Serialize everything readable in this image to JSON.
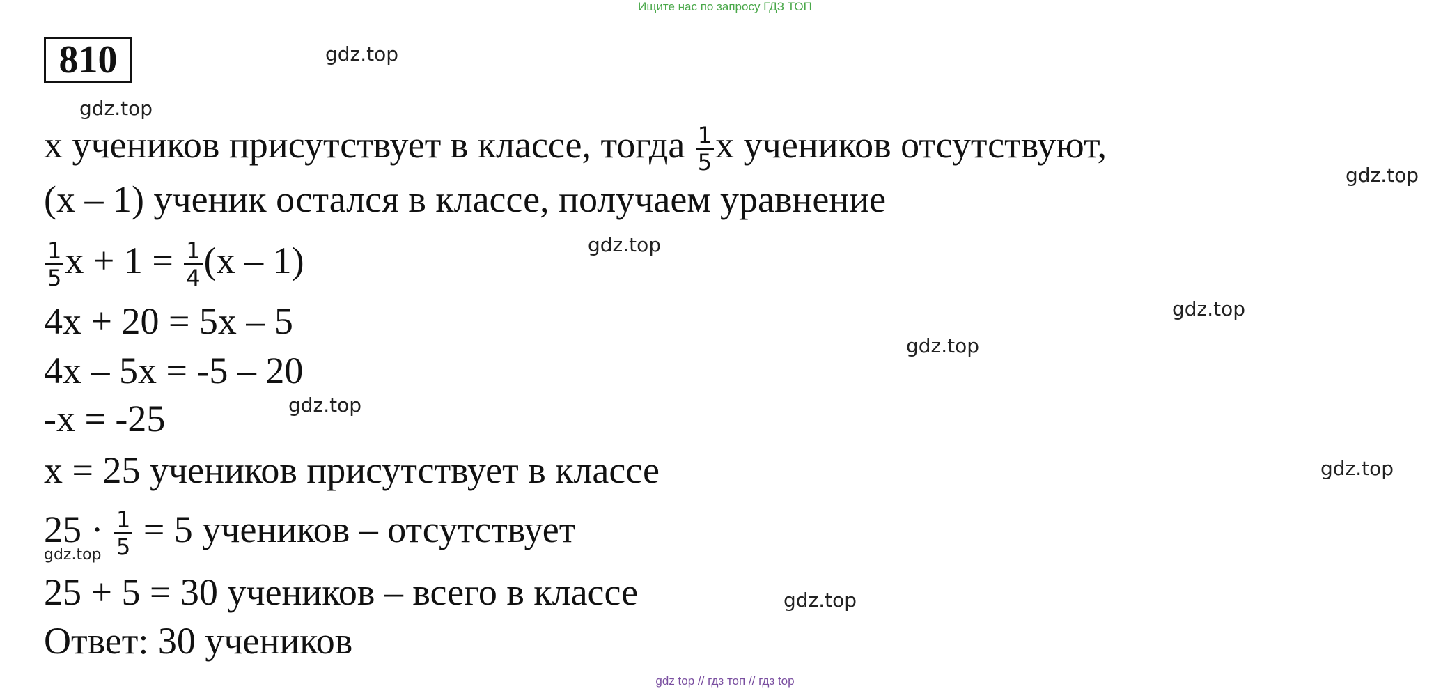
{
  "header": {
    "banner": "Ищите нас по запросу ГДЗ ТОП"
  },
  "problem": {
    "number": "810"
  },
  "watermark": "gdz.top",
  "solution": {
    "line1": {
      "pre": "x учеников присутствует в классе, тогда ",
      "frac_num": "1",
      "frac_den": "5",
      "post": "x учеников отсутствуют,"
    },
    "line2": "(x – 1) ученик остался в классе, получаем уравнение",
    "line3": {
      "frac1_num": "1",
      "frac1_den": "5",
      "mid": "x + 1 = ",
      "frac2_num": "1",
      "frac2_den": "4",
      "post": "(x – 1)"
    },
    "line4": "4x + 20 = 5x – 5",
    "line5": "4x – 5x = -5 – 20",
    "line6": "-x = -25",
    "line7": "x = 25 учеников присутствует в классе",
    "line8": {
      "pre": "25 · ",
      "frac_num": "1",
      "frac_den": "5",
      "post": " = 5 учеников – отсутствует"
    },
    "line9": "25 + 5 = 30 учеников – всего в классе",
    "line10": "Ответ: 30 учеников"
  },
  "footer": {
    "banner": "gdz top  //  гдз топ  //  гдз top"
  }
}
